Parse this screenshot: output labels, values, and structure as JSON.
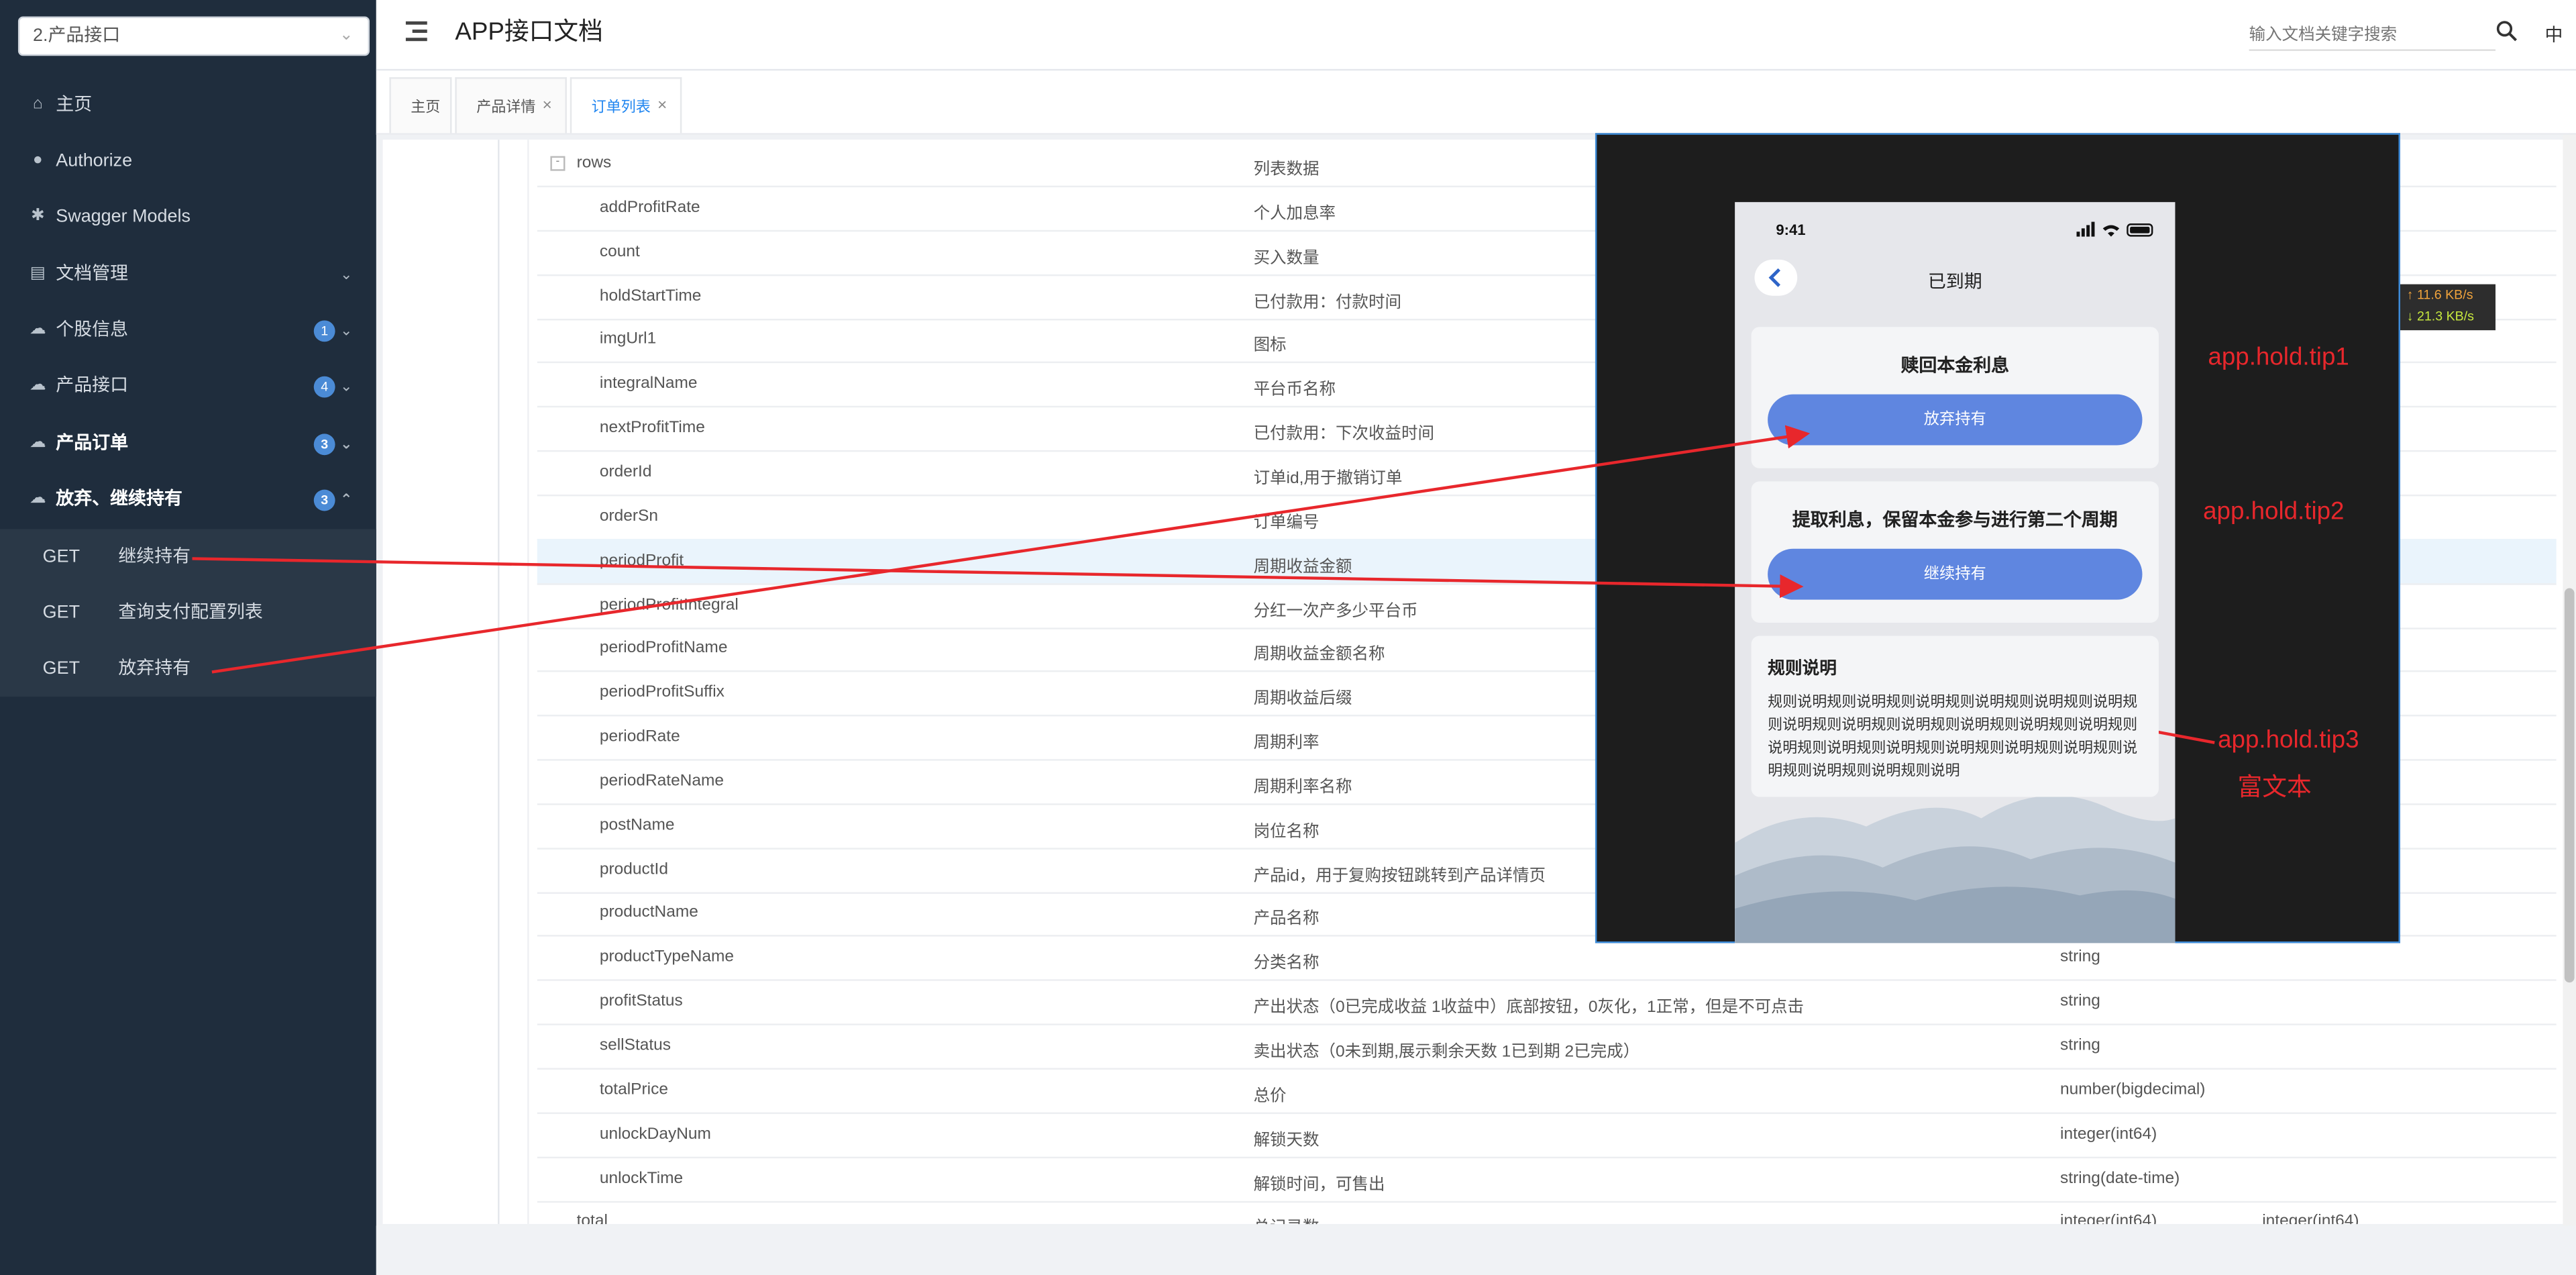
{
  "sidebar": {
    "service_select": "2.产品接口",
    "items": [
      {
        "label": "主页",
        "icon": "home-icon"
      },
      {
        "label": "Authorize",
        "icon": "lock-icon"
      },
      {
        "label": "Swagger Models",
        "icon": "model-icon"
      },
      {
        "label": "文档管理",
        "icon": "document-icon"
      },
      {
        "label": "个股信息",
        "icon": "cloud-icon",
        "badge": "1"
      },
      {
        "label": "产品接口",
        "icon": "cloud-icon",
        "badge": "4"
      },
      {
        "label": "产品订单",
        "icon": "cloud-icon",
        "badge": "3"
      },
      {
        "label": "放弃、继续持有",
        "icon": "cloud-icon",
        "badge": "3"
      }
    ],
    "sub_items": [
      {
        "method": "GET",
        "label": "继续持有"
      },
      {
        "method": "GET",
        "label": "查询支付配置列表"
      },
      {
        "method": "GET",
        "label": "放弃持有"
      }
    ]
  },
  "header": {
    "title": "APP接口文档",
    "search_placeholder": "输入文档关键字搜索",
    "lang": "中"
  },
  "tabs": [
    {
      "label": "主页"
    },
    {
      "label": "产品详情"
    },
    {
      "label": "订单列表"
    }
  ],
  "table": {
    "rows": [
      {
        "name": "rows",
        "desc": "列表数据",
        "type": "",
        "extra": "",
        "toggle": "-"
      },
      {
        "name": "addProfitRate",
        "desc": "个人加息率",
        "type": "",
        "extra": ""
      },
      {
        "name": "count",
        "desc": "买入数量",
        "type": "",
        "extra": ""
      },
      {
        "name": "holdStartTime",
        "desc": "已付款用：付款时间",
        "type": "",
        "extra": ""
      },
      {
        "name": "imgUrl1",
        "desc": "图标",
        "type": "",
        "extra": ""
      },
      {
        "name": "integralName",
        "desc": "平台币名称",
        "type": "",
        "extra": ""
      },
      {
        "name": "nextProfitTime",
        "desc": "已付款用：下次收益时间",
        "type": "",
        "extra": ""
      },
      {
        "name": "orderId",
        "desc": "订单id,用于撤销订单",
        "type": "",
        "extra": ""
      },
      {
        "name": "orderSn",
        "desc": "订单编号",
        "type": "",
        "extra": ""
      },
      {
        "name": "periodProfit",
        "desc": "周期收益金额",
        "type": "",
        "extra": ""
      },
      {
        "name": "periodProfitIntegral",
        "desc": "分红一次产多少平台币",
        "type": "",
        "extra": ""
      },
      {
        "name": "periodProfitName",
        "desc": "周期收益金额名称",
        "type": "",
        "extra": ""
      },
      {
        "name": "periodProfitSuffix",
        "desc": "周期收益后缀",
        "type": "",
        "extra": ""
      },
      {
        "name": "periodRate",
        "desc": "周期利率",
        "type": "",
        "extra": ""
      },
      {
        "name": "periodRateName",
        "desc": "周期利率名称",
        "type": "",
        "extra": ""
      },
      {
        "name": "postName",
        "desc": "岗位名称",
        "type": "",
        "extra": ""
      },
      {
        "name": "productId",
        "desc": "产品id，用于复购按钮跳转到产品详情页",
        "type": "",
        "extra": ""
      },
      {
        "name": "productName",
        "desc": "产品名称",
        "type": "",
        "extra": ""
      },
      {
        "name": "productTypeName",
        "desc": "分类名称",
        "type": "string",
        "extra": ""
      },
      {
        "name": "profitStatus",
        "desc": "产出状态（0已完成收益 1收益中）底部按钮，0灰化，1正常，但是不可点击",
        "type": "string",
        "extra": ""
      },
      {
        "name": "sellStatus",
        "desc": "卖出状态（0未到期,展示剩余天数 1已到期 2已完成）",
        "type": "string",
        "extra": ""
      },
      {
        "name": "totalPrice",
        "desc": "总价",
        "type": "number(bigdecimal)",
        "extra": ""
      },
      {
        "name": "unlockDayNum",
        "desc": "解锁天数",
        "type": "integer(int64)",
        "extra": ""
      },
      {
        "name": "unlockTime",
        "desc": "解锁时间，可售出",
        "type": "string(date-time)",
        "extra": ""
      },
      {
        "name": "total",
        "desc": "总记录数",
        "type": "integer(int64)",
        "extra": "integer(int64)"
      }
    ]
  },
  "overlay": {
    "time": "9:41",
    "title": "已到期",
    "card1_title": "赎回本金利息",
    "card1_button": "放弃持有",
    "card2_title": "提取利息，保留本金参与进行第二个周期",
    "card2_button": "继续持有",
    "rule_title": "规则说明",
    "rule_text": "规则说明规则说明规则说明规则说明规则说明规则说明规则说明规则说明规则说明规则说明规则说明规则说明规则说明规则说明规则说明规则说明规则说明规则说明规则说明规则说明规则说明规则说明",
    "annotations": {
      "tip1": "app.hold.tip1",
      "tip2": "app.hold.tip2",
      "tip3": "app.hold.tip3",
      "rich_text": "富文本"
    }
  },
  "netspeed": {
    "up": "↑ 11.6 KB/s",
    "down": "↓ 21.3 KB/s"
  },
  "colors": {
    "sidebar_bg": "#1f2d3d",
    "accent": "#1f85f0",
    "phone_button": "#5f86e0",
    "annotation": "#e8272c"
  }
}
